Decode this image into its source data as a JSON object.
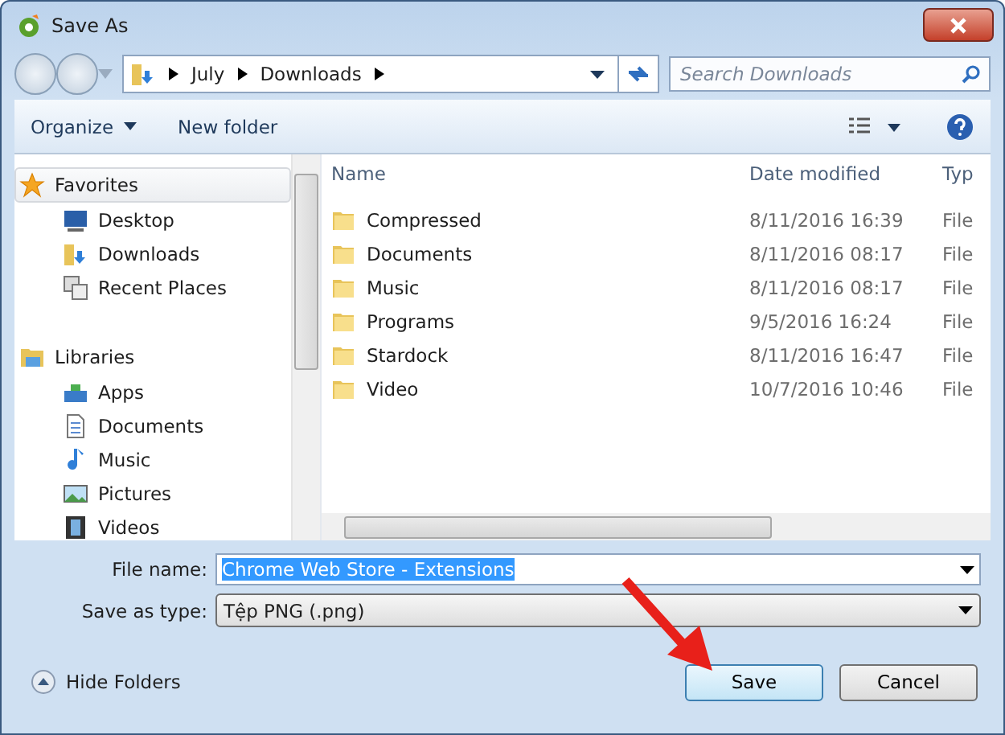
{
  "window": {
    "title": "Save As"
  },
  "address": {
    "crumbs": [
      "July",
      "Downloads"
    ]
  },
  "search": {
    "placeholder": "Search Downloads"
  },
  "toolbar": {
    "buttons": [
      "Organize",
      "New folder"
    ]
  },
  "sidebar": {
    "groups": [
      {
        "label": "Favorites",
        "kind": "favorites",
        "selected": true,
        "children": [
          {
            "label": "Desktop",
            "kind": "desktop"
          },
          {
            "label": "Downloads",
            "kind": "downloads"
          },
          {
            "label": "Recent Places",
            "kind": "recent"
          }
        ]
      },
      {
        "label": "Libraries",
        "kind": "libraries",
        "selected": false,
        "children": [
          {
            "label": "Apps",
            "kind": "apps"
          },
          {
            "label": "Documents",
            "kind": "documents"
          },
          {
            "label": "Music",
            "kind": "music"
          },
          {
            "label": "Pictures",
            "kind": "pictures"
          },
          {
            "label": "Videos",
            "kind": "videos"
          }
        ]
      }
    ]
  },
  "file_list": {
    "columns": [
      "Name",
      "Date modified",
      "Typ"
    ],
    "rows": [
      {
        "name": "Compressed",
        "date": "8/11/2016 16:39",
        "type": "File"
      },
      {
        "name": "Documents",
        "date": "8/11/2016 08:17",
        "type": "File"
      },
      {
        "name": "Music",
        "date": "8/11/2016 08:17",
        "type": "File"
      },
      {
        "name": "Programs",
        "date": "9/5/2016 16:24",
        "type": "File"
      },
      {
        "name": "Stardock",
        "date": "8/11/2016 16:47",
        "type": "File"
      },
      {
        "name": "Video",
        "date": "10/7/2016 10:46",
        "type": "File"
      }
    ]
  },
  "form": {
    "file_name_label": "File name:",
    "file_name": "Chrome Web Store - Extensions",
    "file_name_selected": true,
    "type_label": "Save as type:",
    "type_value": "Tệp PNG (.png)"
  },
  "footer": {
    "hide_folders": "Hide Folders",
    "buttons": [
      "Save",
      "Cancel"
    ]
  }
}
